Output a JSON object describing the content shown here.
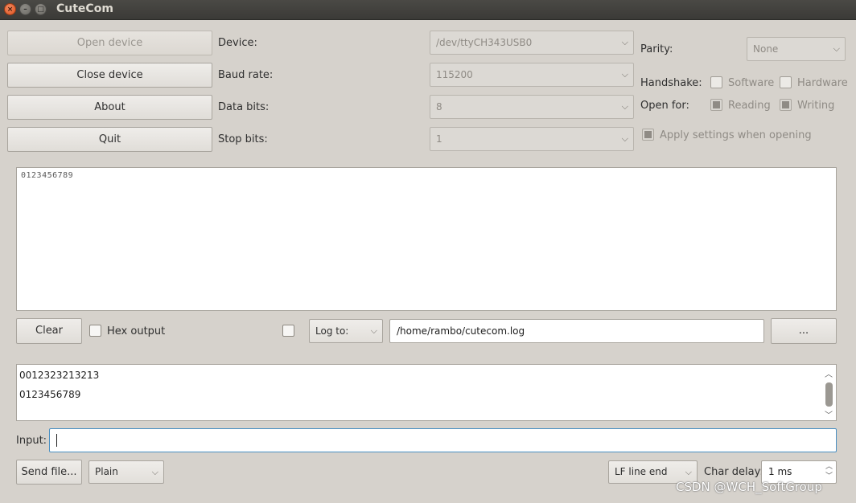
{
  "window": {
    "title": "CuteCom",
    "close_glyph": "×",
    "min_glyph": "–",
    "max_glyph": "□"
  },
  "buttons": {
    "open_device": "Open device",
    "close_device": "Close device",
    "about": "About",
    "quit": "Quit",
    "clear": "Clear",
    "browse": "...",
    "send_file": "Send file..."
  },
  "settings": {
    "device": {
      "label": "Device:",
      "value": "/dev/ttyCH343USB0"
    },
    "baud_rate": {
      "label": "Baud rate:",
      "value": "115200"
    },
    "data_bits": {
      "label": "Data bits:",
      "value": "8"
    },
    "stop_bits": {
      "label": "Stop bits:",
      "value": "1"
    },
    "parity": {
      "label": "Parity:",
      "value": "None"
    },
    "handshake": {
      "label": "Handshake:",
      "software": {
        "label": "Software",
        "checked": false
      },
      "hardware": {
        "label": "Hardware",
        "checked": false
      }
    },
    "open_for": {
      "label": "Open for:",
      "reading": {
        "label": "Reading",
        "checked": true
      },
      "writing": {
        "label": "Writing",
        "checked": true
      }
    },
    "apply_on_open": {
      "label": "Apply settings when opening",
      "checked": true
    }
  },
  "output": {
    "text": "0123456789",
    "hex_output": {
      "label": "Hex output",
      "checked": false
    },
    "log_enabled": false,
    "log_mode": "Log to:",
    "log_path": "/home/rambo/cutecom.log"
  },
  "history": {
    "items": [
      "0012323213213",
      "0123456789"
    ]
  },
  "input": {
    "label": "Input:",
    "value": ""
  },
  "send": {
    "format": "Plain",
    "line_end": "LF line end",
    "char_delay_label": "Char delay:",
    "char_delay_value": "1 ms"
  },
  "icons": {
    "chevron": "⌵",
    "up": "︿",
    "down": "﹀"
  },
  "watermark": "CSDN @WCH_SoftGroup",
  "colors": {
    "window_bg": "#d6d2cc",
    "titlebar": "#3e3d39",
    "close_button": "#e0531f",
    "input_focus": "#4a90c2"
  }
}
